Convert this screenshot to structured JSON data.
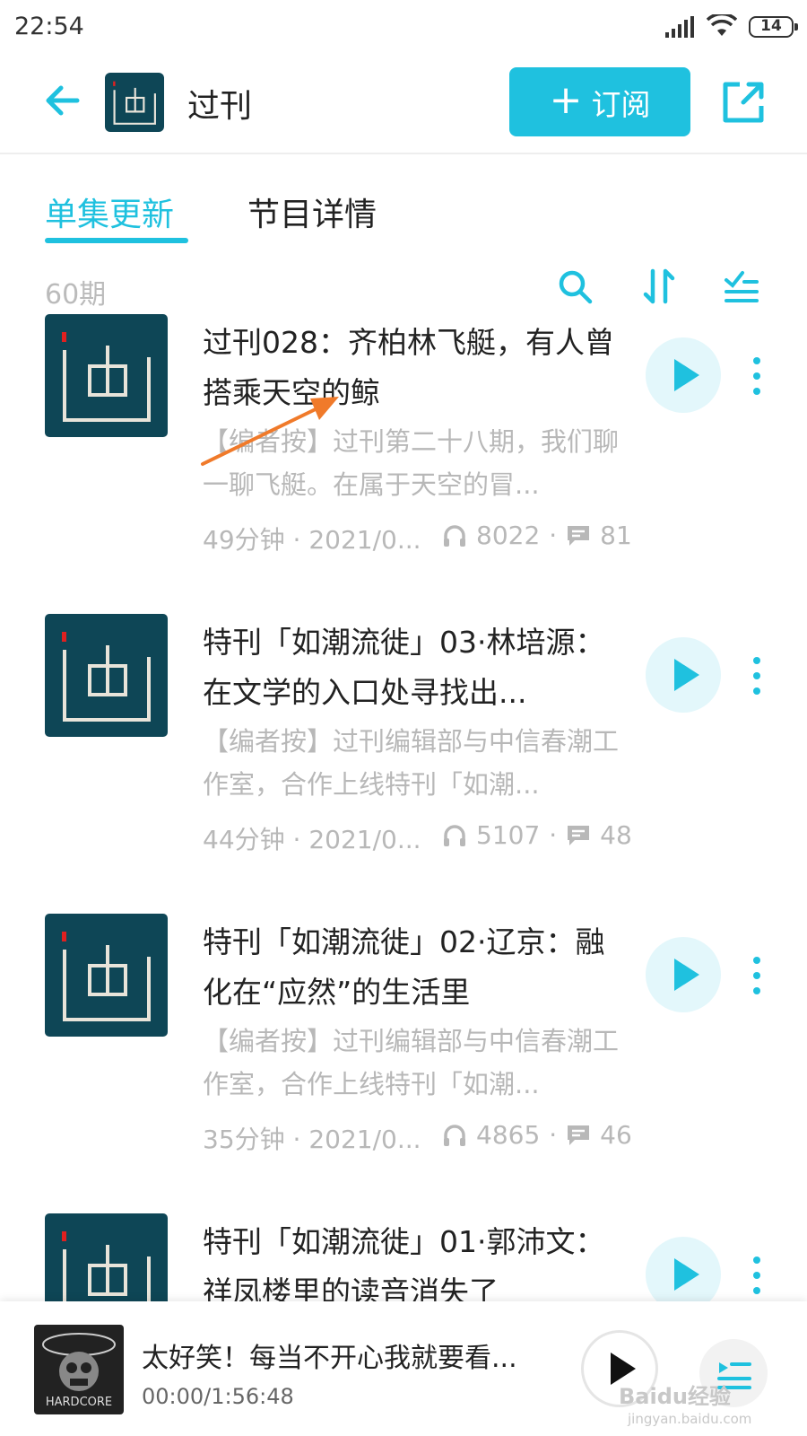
{
  "status_bar": {
    "time": "22:54",
    "battery": "14"
  },
  "header": {
    "title": "过刊",
    "subscribe_label": "订阅",
    "subscribe_plus": "+"
  },
  "tabs": [
    {
      "label": "单集更新"
    },
    {
      "label": "节目详情"
    }
  ],
  "list": {
    "count_label": "60期"
  },
  "episodes": [
    {
      "title": "过刊028：齐柏林飞艇，有人曾搭乘天空的鲸",
      "description": "【编者按】过刊第二十八期，我们聊一聊飞艇。在属于天空的冒...",
      "duration": "49分钟 · 2021/0...",
      "plays": "8022",
      "comments": "81"
    },
    {
      "title": "特刊「如潮流徙」03·林培源：在文学的入口处寻找出...",
      "description": "【编者按】过刊编辑部与中信春潮工作室，合作上线特刊「如潮...",
      "duration": "44分钟 · 2021/0...",
      "plays": "5107",
      "comments": "48"
    },
    {
      "title": "特刊「如潮流徙」02·辽京：融化在“应然”的生活里",
      "description": "【编者按】过刊编辑部与中信春潮工作室，合作上线特刊「如潮...",
      "duration": "35分钟 · 2021/0...",
      "plays": "4865",
      "comments": "46"
    },
    {
      "title": "特刊「如潮流徙」01·郭沛文：祥凤楼里的读音消失了",
      "description": "",
      "duration": "",
      "plays": "",
      "comments": ""
    }
  ],
  "player": {
    "title": "太好笑！每当不开心我就要看...",
    "time": "00:00/1:56:48",
    "thumb_text": "HARDCORE"
  },
  "watermark": {
    "main": "Baidu经验",
    "sub": "jingyan.baidu.com"
  },
  "colors": {
    "accent": "#1fc1df",
    "thumb_bg": "#0e4656",
    "annotation_arrow": "#f07a2a"
  }
}
